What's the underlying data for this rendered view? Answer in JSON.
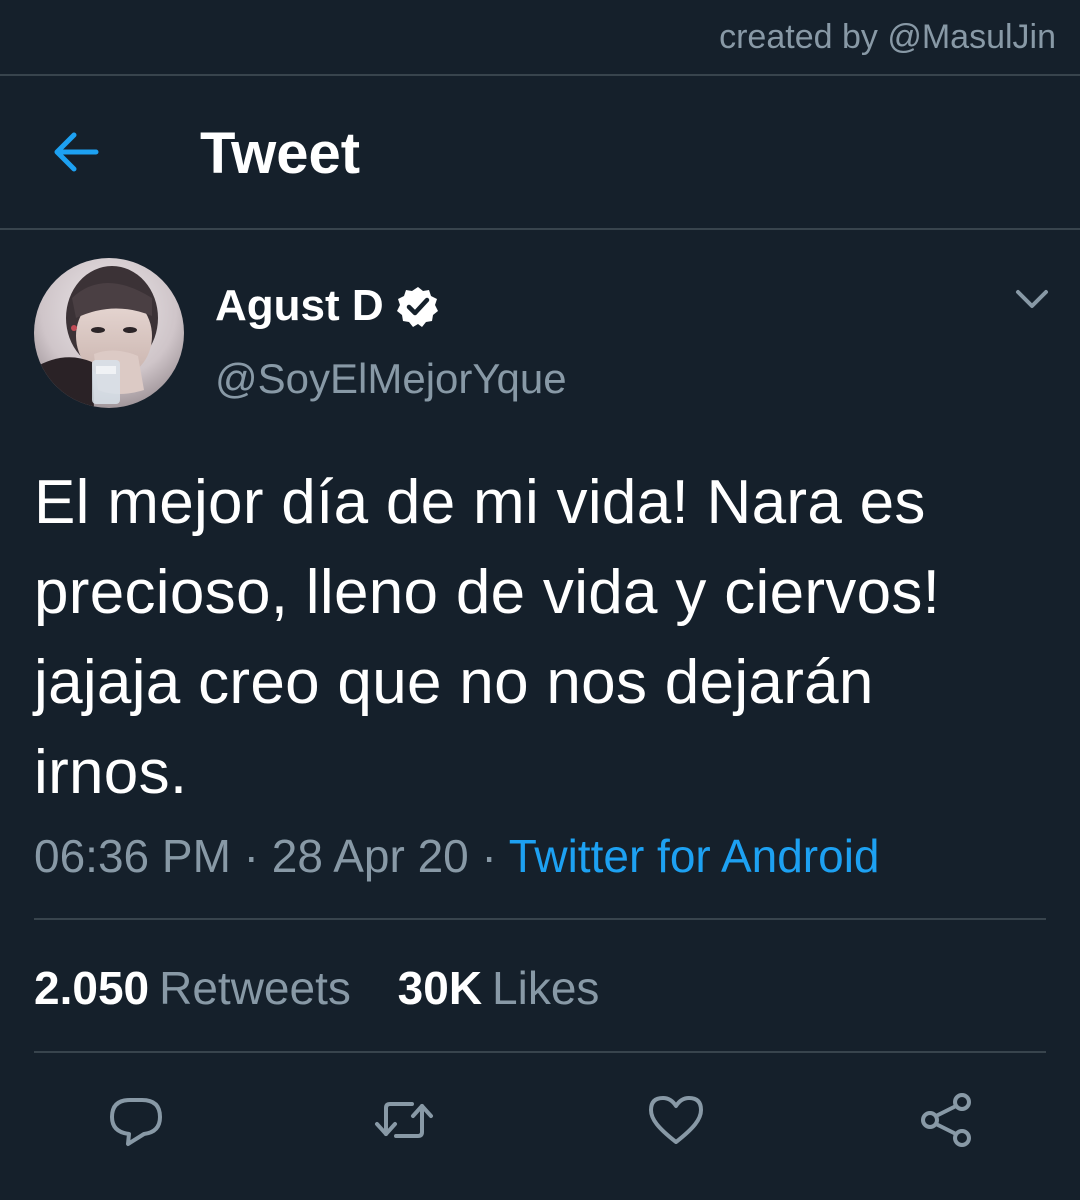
{
  "watermark": "created by @MasulJin",
  "header": {
    "title": "Tweet",
    "back_icon": "back-arrow-icon"
  },
  "colors": {
    "background": "#15202b",
    "divider": "#38444d",
    "accent": "#1da1f2",
    "secondary_text": "#8899a6",
    "primary_text": "#ffffff"
  },
  "tweet": {
    "author": {
      "display_name": "Agust D",
      "handle": "@SoyElMejorYque",
      "verified": true
    },
    "text": "El mejor día de mi vida!  Nara es\nprecioso, lleno de vida y ciervos!\njajaja creo que no nos dejarán\nirnos.",
    "time": "06:36 PM",
    "date": "28 Apr 20",
    "separator": " · ",
    "source": "Twitter for Android",
    "stats": {
      "retweets_count": "2.050",
      "retweets_label": "Retweets",
      "likes_count": "30K",
      "likes_label": "Likes"
    }
  },
  "actions": [
    {
      "icon": "reply-icon"
    },
    {
      "icon": "retweet-icon"
    },
    {
      "icon": "like-icon"
    },
    {
      "icon": "share-icon"
    }
  ]
}
